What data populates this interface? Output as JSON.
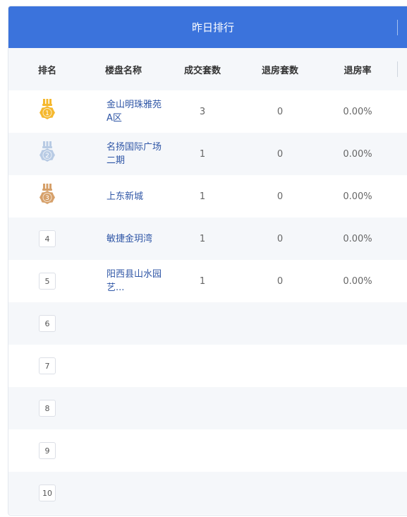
{
  "panel": {
    "title": "昨日排行"
  },
  "columns": {
    "rank": "排名",
    "name": "楼盘名称",
    "sold": "成交套数",
    "refund": "退房套数",
    "refund_rate": "退房率"
  },
  "rows": [
    {
      "rank": "1",
      "name": "金山明珠雅苑A区",
      "sold": "3",
      "refund": "0",
      "rate": "0.00%",
      "medal": "gold"
    },
    {
      "rank": "2",
      "name": "名扬国际广场二期",
      "sold": "1",
      "refund": "0",
      "rate": "0.00%",
      "medal": "silver"
    },
    {
      "rank": "3",
      "name": "上东新城",
      "sold": "1",
      "refund": "0",
      "rate": "0.00%",
      "medal": "bronze"
    },
    {
      "rank": "4",
      "name": "敏捷金玥湾",
      "sold": "1",
      "refund": "0",
      "rate": "0.00%"
    },
    {
      "rank": "5",
      "name": "阳西县山水园艺...",
      "sold": "1",
      "refund": "0",
      "rate": "0.00%"
    },
    {
      "rank": "6",
      "name": "",
      "sold": "",
      "refund": "",
      "rate": ""
    },
    {
      "rank": "7",
      "name": "",
      "sold": "",
      "refund": "",
      "rate": ""
    },
    {
      "rank": "8",
      "name": "",
      "sold": "",
      "refund": "",
      "rate": ""
    },
    {
      "rank": "9",
      "name": "",
      "sold": "",
      "refund": "",
      "rate": ""
    },
    {
      "rank": "10",
      "name": "",
      "sold": "",
      "refund": "",
      "rate": ""
    }
  ],
  "colors": {
    "header_bg": "#3b73dc",
    "stripe_bg": "#f5f7fa",
    "link": "#2f56a6",
    "gold": "#f5b82e",
    "silver": "#b8cbe4",
    "bronze": "#d6a06a"
  }
}
